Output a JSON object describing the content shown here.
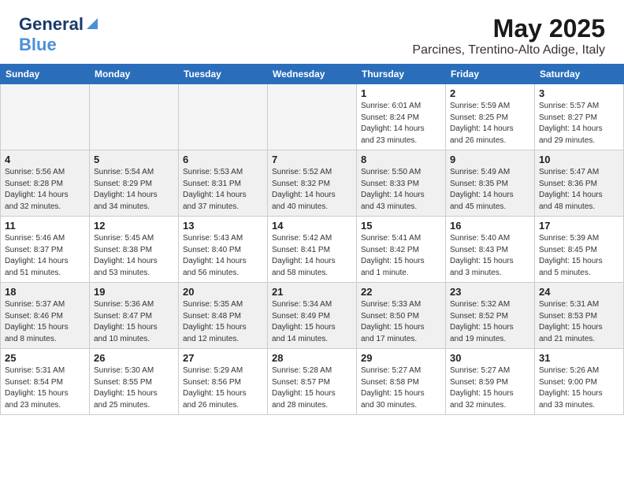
{
  "header": {
    "logo_general": "General",
    "logo_blue": "Blue",
    "month": "May 2025",
    "location": "Parcines, Trentino-Alto Adige, Italy"
  },
  "days_of_week": [
    "Sunday",
    "Monday",
    "Tuesday",
    "Wednesday",
    "Thursday",
    "Friday",
    "Saturday"
  ],
  "weeks": [
    {
      "days": [
        {
          "num": "",
          "info": ""
        },
        {
          "num": "",
          "info": ""
        },
        {
          "num": "",
          "info": ""
        },
        {
          "num": "",
          "info": ""
        },
        {
          "num": "1",
          "info": "Sunrise: 6:01 AM\nSunset: 8:24 PM\nDaylight: 14 hours\nand 23 minutes."
        },
        {
          "num": "2",
          "info": "Sunrise: 5:59 AM\nSunset: 8:25 PM\nDaylight: 14 hours\nand 26 minutes."
        },
        {
          "num": "3",
          "info": "Sunrise: 5:57 AM\nSunset: 8:27 PM\nDaylight: 14 hours\nand 29 minutes."
        }
      ]
    },
    {
      "days": [
        {
          "num": "4",
          "info": "Sunrise: 5:56 AM\nSunset: 8:28 PM\nDaylight: 14 hours\nand 32 minutes."
        },
        {
          "num": "5",
          "info": "Sunrise: 5:54 AM\nSunset: 8:29 PM\nDaylight: 14 hours\nand 34 minutes."
        },
        {
          "num": "6",
          "info": "Sunrise: 5:53 AM\nSunset: 8:31 PM\nDaylight: 14 hours\nand 37 minutes."
        },
        {
          "num": "7",
          "info": "Sunrise: 5:52 AM\nSunset: 8:32 PM\nDaylight: 14 hours\nand 40 minutes."
        },
        {
          "num": "8",
          "info": "Sunrise: 5:50 AM\nSunset: 8:33 PM\nDaylight: 14 hours\nand 43 minutes."
        },
        {
          "num": "9",
          "info": "Sunrise: 5:49 AM\nSunset: 8:35 PM\nDaylight: 14 hours\nand 45 minutes."
        },
        {
          "num": "10",
          "info": "Sunrise: 5:47 AM\nSunset: 8:36 PM\nDaylight: 14 hours\nand 48 minutes."
        }
      ]
    },
    {
      "days": [
        {
          "num": "11",
          "info": "Sunrise: 5:46 AM\nSunset: 8:37 PM\nDaylight: 14 hours\nand 51 minutes."
        },
        {
          "num": "12",
          "info": "Sunrise: 5:45 AM\nSunset: 8:38 PM\nDaylight: 14 hours\nand 53 minutes."
        },
        {
          "num": "13",
          "info": "Sunrise: 5:43 AM\nSunset: 8:40 PM\nDaylight: 14 hours\nand 56 minutes."
        },
        {
          "num": "14",
          "info": "Sunrise: 5:42 AM\nSunset: 8:41 PM\nDaylight: 14 hours\nand 58 minutes."
        },
        {
          "num": "15",
          "info": "Sunrise: 5:41 AM\nSunset: 8:42 PM\nDaylight: 15 hours\nand 1 minute."
        },
        {
          "num": "16",
          "info": "Sunrise: 5:40 AM\nSunset: 8:43 PM\nDaylight: 15 hours\nand 3 minutes."
        },
        {
          "num": "17",
          "info": "Sunrise: 5:39 AM\nSunset: 8:45 PM\nDaylight: 15 hours\nand 5 minutes."
        }
      ]
    },
    {
      "days": [
        {
          "num": "18",
          "info": "Sunrise: 5:37 AM\nSunset: 8:46 PM\nDaylight: 15 hours\nand 8 minutes."
        },
        {
          "num": "19",
          "info": "Sunrise: 5:36 AM\nSunset: 8:47 PM\nDaylight: 15 hours\nand 10 minutes."
        },
        {
          "num": "20",
          "info": "Sunrise: 5:35 AM\nSunset: 8:48 PM\nDaylight: 15 hours\nand 12 minutes."
        },
        {
          "num": "21",
          "info": "Sunrise: 5:34 AM\nSunset: 8:49 PM\nDaylight: 15 hours\nand 14 minutes."
        },
        {
          "num": "22",
          "info": "Sunrise: 5:33 AM\nSunset: 8:50 PM\nDaylight: 15 hours\nand 17 minutes."
        },
        {
          "num": "23",
          "info": "Sunrise: 5:32 AM\nSunset: 8:52 PM\nDaylight: 15 hours\nand 19 minutes."
        },
        {
          "num": "24",
          "info": "Sunrise: 5:31 AM\nSunset: 8:53 PM\nDaylight: 15 hours\nand 21 minutes."
        }
      ]
    },
    {
      "days": [
        {
          "num": "25",
          "info": "Sunrise: 5:31 AM\nSunset: 8:54 PM\nDaylight: 15 hours\nand 23 minutes."
        },
        {
          "num": "26",
          "info": "Sunrise: 5:30 AM\nSunset: 8:55 PM\nDaylight: 15 hours\nand 25 minutes."
        },
        {
          "num": "27",
          "info": "Sunrise: 5:29 AM\nSunset: 8:56 PM\nDaylight: 15 hours\nand 26 minutes."
        },
        {
          "num": "28",
          "info": "Sunrise: 5:28 AM\nSunset: 8:57 PM\nDaylight: 15 hours\nand 28 minutes."
        },
        {
          "num": "29",
          "info": "Sunrise: 5:27 AM\nSunset: 8:58 PM\nDaylight: 15 hours\nand 30 minutes."
        },
        {
          "num": "30",
          "info": "Sunrise: 5:27 AM\nSunset: 8:59 PM\nDaylight: 15 hours\nand 32 minutes."
        },
        {
          "num": "31",
          "info": "Sunrise: 5:26 AM\nSunset: 9:00 PM\nDaylight: 15 hours\nand 33 minutes."
        }
      ]
    }
  ]
}
